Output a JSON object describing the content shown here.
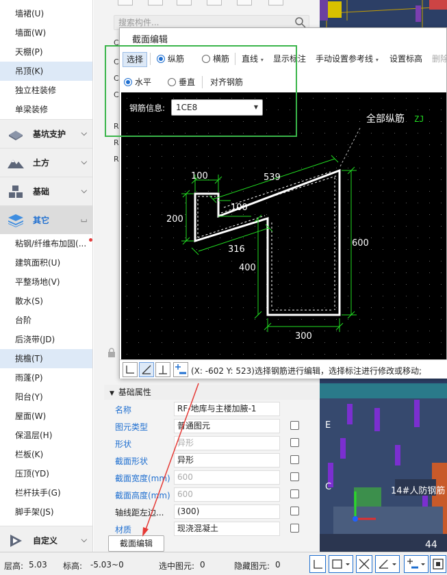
{
  "nav": {
    "items_top": [
      {
        "label": "墙裙(U)"
      },
      {
        "label": "墙面(W)"
      },
      {
        "label": "天棚(P)"
      },
      {
        "label": "吊顶(K)",
        "active": true
      },
      {
        "label": "独立柱装修"
      },
      {
        "label": "单梁装修"
      }
    ],
    "categories": [
      {
        "label": "基坑支护",
        "icon": "excavation-support-icon"
      },
      {
        "label": "土方",
        "icon": "earthwork-icon"
      },
      {
        "label": "基础",
        "icon": "foundation-icon"
      },
      {
        "label": "其它",
        "icon": "other-layers-icon",
        "active": true
      }
    ],
    "items_other": [
      {
        "label": "粘钢/纤维布加固(..."
      },
      {
        "label": "建筑面积(U)"
      },
      {
        "label": "平整场地(V)"
      },
      {
        "label": "散水(S)"
      },
      {
        "label": "台阶"
      },
      {
        "label": "后浇带(JD)"
      },
      {
        "label": "挑檐(T)",
        "active": true
      },
      {
        "label": "雨蓬(P)"
      },
      {
        "label": "阳台(Y)"
      },
      {
        "label": "屋面(W)"
      },
      {
        "label": "保温层(H)"
      },
      {
        "label": "栏板(K)"
      },
      {
        "label": "压顶(YD)"
      },
      {
        "label": "栏杆扶手(G)"
      },
      {
        "label": "脚手架(JS)"
      }
    ],
    "custom": {
      "label": "自定义",
      "icon": "custom-play-icon"
    }
  },
  "search": {
    "placeholder": "搜索构件..."
  },
  "list_letters": [
    "C",
    "C",
    "C",
    "C",
    "R",
    "R",
    "R"
  ],
  "dialog": {
    "title": "截面编辑",
    "toolbar1": {
      "select": "选择",
      "longitudinal": "纵筋",
      "transverse": "横筋",
      "line": "直线",
      "show_dims": "显示标注",
      "manual_ref": "手动设置参考线",
      "set_elev": "设置标高",
      "delete": "删除"
    },
    "toolbar2": {
      "horizontal": "水平",
      "vertical": "垂直",
      "align": "对齐钢筋"
    },
    "rebar_info_label": "钢筋信息:",
    "rebar_info_value": "1CE8",
    "canvas": {
      "all_rebar_label": "全部纵筋",
      "zj_tag": "ZJ",
      "dims": {
        "d100a": "100",
        "d539": "539",
        "d100b": "100",
        "d200": "200",
        "d316": "316",
        "d600": "600",
        "d400": "400",
        "d300": "300"
      }
    },
    "status": "(X: -602 Y: 523)选择钢筋进行编辑，选择标注进行修改或移动;"
  },
  "props": {
    "header": "基础属性",
    "rows": [
      {
        "label": "名称",
        "value": "RF-地库与主楼加腋-1",
        "blue": true,
        "gray": false,
        "check": false
      },
      {
        "label": "图元类型",
        "value": "普通图元",
        "blue": true,
        "gray": false,
        "check": true
      },
      {
        "label": "形状",
        "value": "异形",
        "blue": true,
        "gray": true,
        "check": true
      },
      {
        "label": "截面形状",
        "value": "异形",
        "blue": true,
        "gray": false,
        "check": true
      },
      {
        "label": "截面宽度(mm)",
        "value": "600",
        "blue": true,
        "gray": true,
        "check": true
      },
      {
        "label": "截面高度(mm)",
        "value": "600",
        "blue": true,
        "gray": true,
        "check": true
      },
      {
        "label": "轴线距左边...",
        "value": "(300)",
        "blue": false,
        "gray": false,
        "check": true
      },
      {
        "label": "材质",
        "value": "现浇混凝土",
        "blue": true,
        "gray": false,
        "check": true
      }
    ],
    "edit_button": "截面编辑"
  },
  "view3d": {
    "tag_e": "E",
    "tag_c": "C",
    "building_label": "14#人防钢筋",
    "corner": "44"
  },
  "bottom": {
    "floor_height_label": "层高:",
    "floor_height": "5.03",
    "elev_label": "标高:",
    "elev": "-5.03~0",
    "selected_label": "选中图元:",
    "selected": "0",
    "hidden_label": "隐藏图元:",
    "hidden": "0"
  },
  "colors": {
    "accent": "#1f6fd0",
    "highlight_box": "#3ab54a",
    "canvas_bg": "#000000"
  }
}
